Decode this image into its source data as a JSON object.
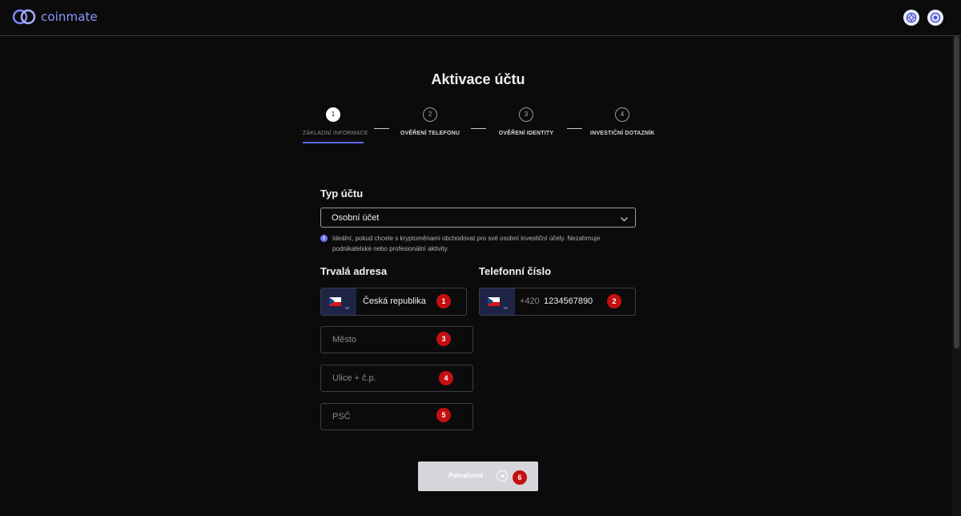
{
  "header": {
    "logo_text": "coinmate",
    "icons": [
      "support-icon",
      "settings-icon"
    ]
  },
  "page": {
    "title": "Aktivace účtu"
  },
  "steps": [
    {
      "number": "1",
      "label": "ZÁKLADNÍ INFORMACE",
      "active": true
    },
    {
      "number": "2",
      "label": "OVĚŘENÍ TELEFONU",
      "active": false
    },
    {
      "number": "3",
      "label": "OVĚŘENÍ IDENTITY",
      "active": false
    },
    {
      "number": "4",
      "label": "INVESTIČNÍ DOTAZNÍK",
      "active": false
    }
  ],
  "account_type": {
    "label": "Typ účtu",
    "selected": "Osobní účet",
    "info": "Ideální, pokud chcete s kryptoměnami obchodovat pro své osobní investiční účely. Nezahrnuje podnikatelské nebo profesionální aktivity."
  },
  "address": {
    "label": "Trvalá adresa",
    "country": "Česká republika",
    "city_placeholder": "Město",
    "street_placeholder": "Ulice + č.p.",
    "zip_placeholder": "PSČ"
  },
  "phone": {
    "label": "Telefonní číslo",
    "prefix": "+420",
    "number": "1234567890"
  },
  "markers": [
    "1",
    "2",
    "3",
    "4",
    "5",
    "6"
  ],
  "continue_button": {
    "label": "Pokračovat"
  },
  "colors": {
    "accent": "#5a67e8",
    "marker": "#c40f10",
    "flag_bg": "#1e2445",
    "button": "#d6d6da"
  }
}
